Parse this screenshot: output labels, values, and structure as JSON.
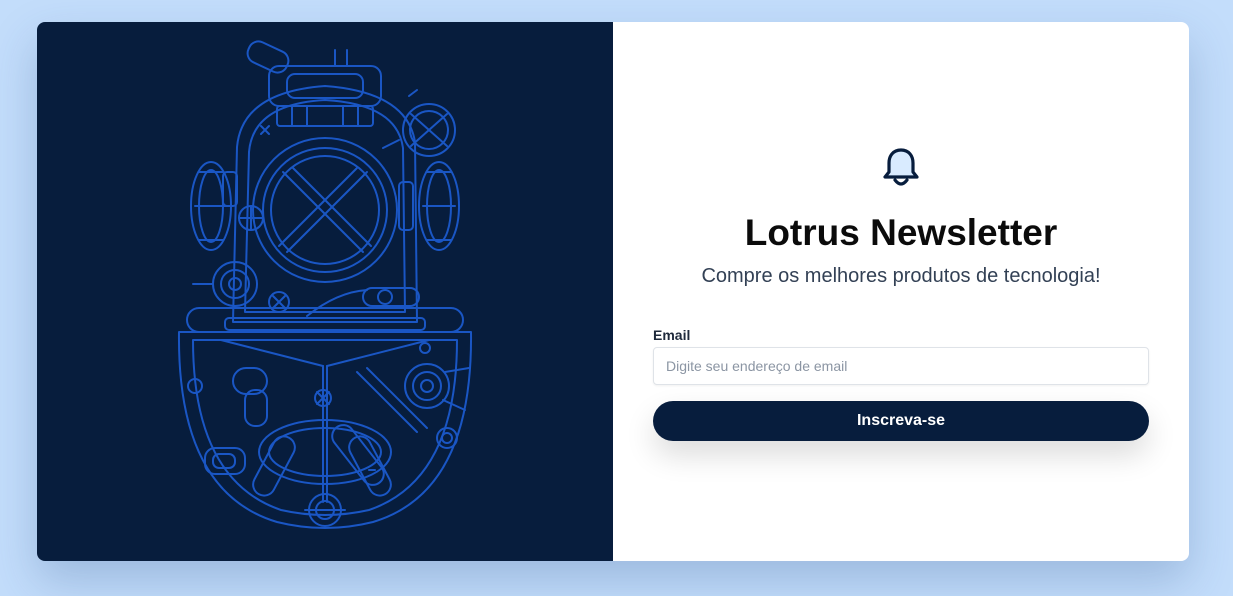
{
  "colors": {
    "page_background": "#c3ddfb",
    "panel_dark": "#071d3d",
    "illustration_stroke": "#1a56c4",
    "button_background": "#071d3d",
    "button_text": "#ffffff"
  },
  "illustration": {
    "icon": "diving-helmet-icon"
  },
  "newsletter": {
    "icon": "bell-icon",
    "title": "Lotrus Newsletter",
    "subtitle": "Compre os melhores produtos de tecnologia!",
    "email_label": "Email",
    "email_value": "",
    "email_placeholder": "Digite seu endereço de email",
    "submit_label": "Inscreva-se"
  }
}
